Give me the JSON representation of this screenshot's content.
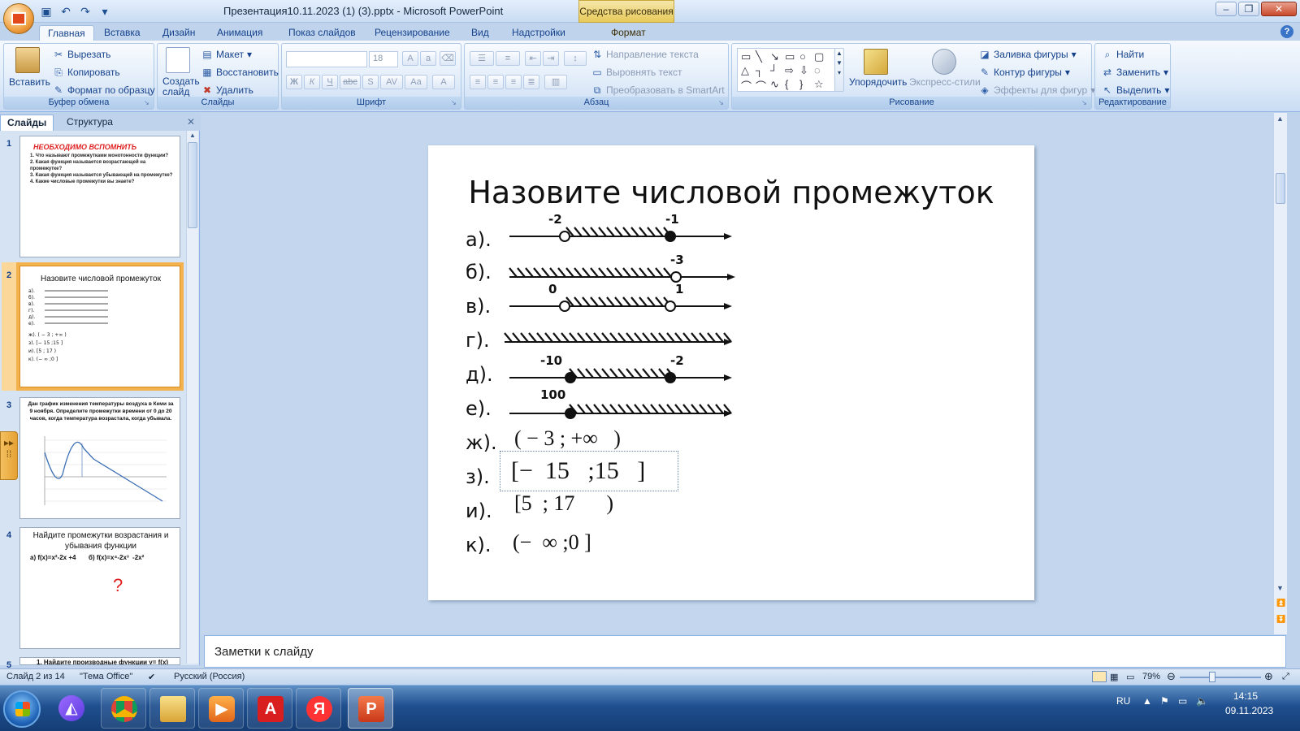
{
  "window": {
    "title": "Презентация10.11.2023 (1) (3).pptx - Microsoft PowerPoint",
    "context_tab": "Средства рисования"
  },
  "tabs": [
    "Главная",
    "Вставка",
    "Дизайн",
    "Анимация",
    "Показ слайдов",
    "Рецензирование",
    "Вид",
    "Надстройки",
    "Формат"
  ],
  "ribbon": {
    "clipboard": {
      "label": "Буфер обмена",
      "paste": "Вставить",
      "cut": "Вырезать",
      "copy": "Копировать",
      "format_painter": "Формат по образцу"
    },
    "slides": {
      "label": "Слайды",
      "new_slide": "Создать слайд",
      "layout": "Макет",
      "reset": "Восстановить",
      "delete": "Удалить"
    },
    "font": {
      "label": "Шрифт",
      "font_name": "",
      "font_size": "18"
    },
    "paragraph": {
      "label": "Абзац",
      "text_direction": "Направление текста",
      "align_text": "Выровнять текст",
      "smartart": "Преобразовать в SmartArt"
    },
    "drawing": {
      "label": "Рисование",
      "arrange": "Упорядочить",
      "quick_styles": "Экспресс-стили",
      "shape_fill": "Заливка фигуры",
      "shape_outline": "Контур фигуры",
      "shape_effects": "Эффекты для фигур"
    },
    "editing": {
      "label": "Редактирование",
      "find": "Найти",
      "replace": "Заменить",
      "select": "Выделить"
    }
  },
  "left_pane": {
    "tab_slides": "Слайды",
    "tab_outline": "Структура",
    "thumbnails": [
      {
        "num": "1",
        "title": "НЕОБХОДИМО ВСПОМНИТЬ",
        "lines": [
          "1. Что называют промежутками монотонности функции?",
          "2. Какая функция называется возрастающей на промежутке?",
          "3. Какая функция называется убывающей на промежутке?",
          "4. Какие числовые промежутки вы знаете?"
        ]
      },
      {
        "num": "2",
        "title": "Назовите числовой промежуток"
      },
      {
        "num": "3",
        "title": "Дан график изменения температуры воздуха в Кеми за 9 ноября. Определите промежутки времени от 0 до 20 часов, когда температура возрастала, когда убывала."
      },
      {
        "num": "4",
        "title": "Найдите промежутки возрастания и убывания функции",
        "line": "а) f(x)=x²-2x +4       б) f(x)=x⁴-2x³  -2x²",
        "mark": "?"
      },
      {
        "num": "5",
        "title": "1. Найдите производные функции y= f(x)"
      }
    ]
  },
  "slide": {
    "title": "Назовите числовой промежуток",
    "rows": [
      {
        "label": "а).",
        "nums": [
          "-2",
          "-1"
        ]
      },
      {
        "label": "б).",
        "nums": [
          "-3"
        ]
      },
      {
        "label": "в).",
        "nums": [
          "0",
          "1"
        ]
      },
      {
        "label": "г).",
        "nums": []
      },
      {
        "label": "д).",
        "nums": [
          "-10",
          "-2"
        ]
      },
      {
        "label": "е).",
        "nums": [
          "100"
        ]
      },
      {
        "label": "ж).",
        "formula": "( − 3 ; +∞   )"
      },
      {
        "label": "з).",
        "formula": "[−  15   ;15   ]"
      },
      {
        "label": "и).",
        "formula": "[5  ; 17      )"
      },
      {
        "label": "к).",
        "formula": "(−  ∞ ;0 ]"
      }
    ]
  },
  "notes": {
    "placeholder": "Заметки к слайду"
  },
  "status": {
    "slide_info": "Слайд 2 из 14",
    "theme": "\"Тема Office\"",
    "language": "Русский (Россия)",
    "zoom": "79%"
  },
  "taskbar": {
    "lang": "RU",
    "time": "14:15",
    "date": "09.11.2023"
  }
}
